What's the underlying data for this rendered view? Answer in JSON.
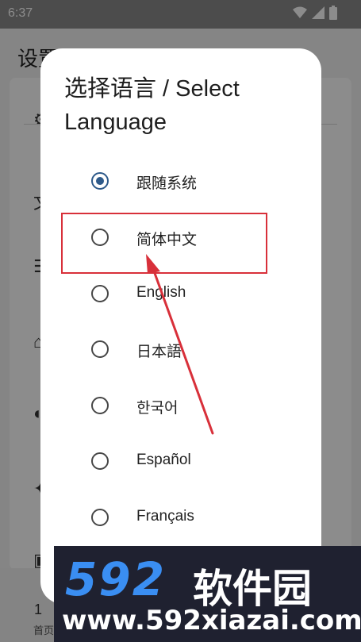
{
  "status_bar": {
    "time": "6:37"
  },
  "background_page": {
    "title": "设置",
    "bottom_nav_number": "1",
    "bottom_nav_label": "首页"
  },
  "dialog": {
    "title": "选择语言 / Select Language",
    "options": [
      {
        "label": "跟随系统",
        "selected": true
      },
      {
        "label": "简体中文",
        "selected": false
      },
      {
        "label": "English",
        "selected": false
      },
      {
        "label": "日本語",
        "selected": false
      },
      {
        "label": "한국어",
        "selected": false
      },
      {
        "label": "Español",
        "selected": false
      },
      {
        "label": "Français",
        "selected": false
      }
    ]
  },
  "annotation": {
    "highlighted_option": "简体中文",
    "color": "#d8303a"
  },
  "watermark": {
    "logo": "592",
    "brand": "软件园",
    "url": "www.592xiazai.com"
  },
  "colors": {
    "accent": "#2e5a8a",
    "annotation": "#d8303a",
    "watermark_blue": "#3a8ef2"
  }
}
